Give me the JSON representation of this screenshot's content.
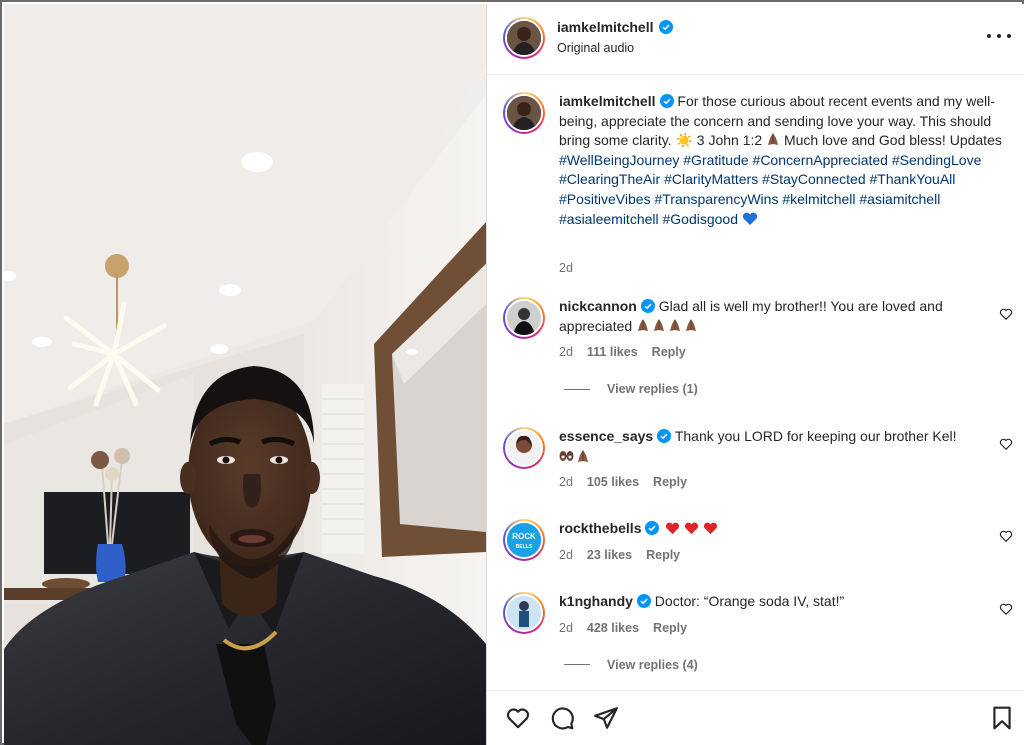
{
  "post": {
    "username": "iamkelmitchell",
    "subtitle": "Original audio",
    "caption": {
      "username": "iamkelmitchell",
      "text_1": "For those curious about recent events and my well-being, appreciate the concern and sending love your way. This should bring some clarity. ",
      "text_2": " 3 John 1:2 ",
      "text_3": " Much love and God bless! Updates ",
      "hashtags": [
        "#WellBeingJourney",
        "#Gratitude",
        "#ConcernAppreciated",
        "#SendingLove",
        "#ClearingTheAir",
        "#ClarityMatters",
        "#StayConnected",
        "#ThankYouAll",
        "#PositiveVibes",
        "#TransparencyWins",
        "#kelmitchell",
        "#asiamitchell",
        "#asialeemitchell",
        "#Godisgood"
      ],
      "age": "2d"
    }
  },
  "comments": [
    {
      "username": "nickcannon",
      "text": "Glad all is well my brother!! You are loved and appreciated",
      "age": "2d",
      "likes": "111 likes",
      "reply": "Reply",
      "view_replies": "View replies (1)"
    },
    {
      "username": "essence_says",
      "text": "Thank you LORD for keeping our brother Kel!",
      "age": "2d",
      "likes": "105 likes",
      "reply": "Reply"
    },
    {
      "username": "rockthebells",
      "text": "",
      "age": "2d",
      "likes": "23 likes",
      "reply": "Reply"
    },
    {
      "username": "k1nghandy",
      "text": "Doctor: “Orange soda IV, stat!”",
      "age": "2d",
      "likes": "428 likes",
      "reply": "Reply",
      "view_replies": "View replies (4)"
    }
  ],
  "icons": {
    "more": "more-horizontal-icon",
    "like": "heart-icon",
    "comment": "comment-icon",
    "share": "paper-plane-icon",
    "save": "bookmark-icon"
  },
  "colors": {
    "hashtag": "#00376b",
    "verified": "#0095f6",
    "meta": "#737373"
  }
}
